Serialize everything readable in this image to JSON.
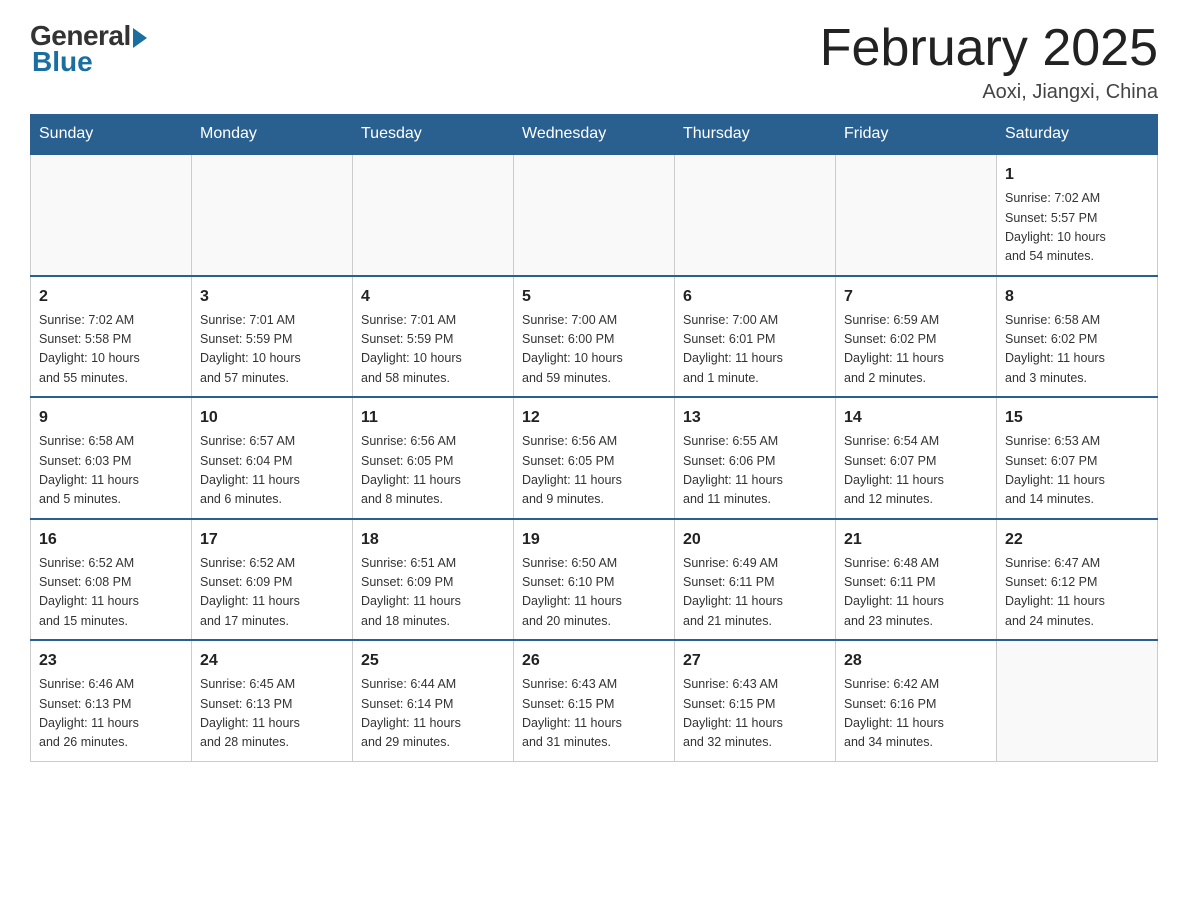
{
  "header": {
    "logo_general": "General",
    "logo_blue": "Blue",
    "month_title": "February 2025",
    "location": "Aoxi, Jiangxi, China"
  },
  "weekdays": [
    "Sunday",
    "Monday",
    "Tuesday",
    "Wednesday",
    "Thursday",
    "Friday",
    "Saturday"
  ],
  "weeks": [
    [
      {
        "day": "",
        "info": ""
      },
      {
        "day": "",
        "info": ""
      },
      {
        "day": "",
        "info": ""
      },
      {
        "day": "",
        "info": ""
      },
      {
        "day": "",
        "info": ""
      },
      {
        "day": "",
        "info": ""
      },
      {
        "day": "1",
        "info": "Sunrise: 7:02 AM\nSunset: 5:57 PM\nDaylight: 10 hours\nand 54 minutes."
      }
    ],
    [
      {
        "day": "2",
        "info": "Sunrise: 7:02 AM\nSunset: 5:58 PM\nDaylight: 10 hours\nand 55 minutes."
      },
      {
        "day": "3",
        "info": "Sunrise: 7:01 AM\nSunset: 5:59 PM\nDaylight: 10 hours\nand 57 minutes."
      },
      {
        "day": "4",
        "info": "Sunrise: 7:01 AM\nSunset: 5:59 PM\nDaylight: 10 hours\nand 58 minutes."
      },
      {
        "day": "5",
        "info": "Sunrise: 7:00 AM\nSunset: 6:00 PM\nDaylight: 10 hours\nand 59 minutes."
      },
      {
        "day": "6",
        "info": "Sunrise: 7:00 AM\nSunset: 6:01 PM\nDaylight: 11 hours\nand 1 minute."
      },
      {
        "day": "7",
        "info": "Sunrise: 6:59 AM\nSunset: 6:02 PM\nDaylight: 11 hours\nand 2 minutes."
      },
      {
        "day": "8",
        "info": "Sunrise: 6:58 AM\nSunset: 6:02 PM\nDaylight: 11 hours\nand 3 minutes."
      }
    ],
    [
      {
        "day": "9",
        "info": "Sunrise: 6:58 AM\nSunset: 6:03 PM\nDaylight: 11 hours\nand 5 minutes."
      },
      {
        "day": "10",
        "info": "Sunrise: 6:57 AM\nSunset: 6:04 PM\nDaylight: 11 hours\nand 6 minutes."
      },
      {
        "day": "11",
        "info": "Sunrise: 6:56 AM\nSunset: 6:05 PM\nDaylight: 11 hours\nand 8 minutes."
      },
      {
        "day": "12",
        "info": "Sunrise: 6:56 AM\nSunset: 6:05 PM\nDaylight: 11 hours\nand 9 minutes."
      },
      {
        "day": "13",
        "info": "Sunrise: 6:55 AM\nSunset: 6:06 PM\nDaylight: 11 hours\nand 11 minutes."
      },
      {
        "day": "14",
        "info": "Sunrise: 6:54 AM\nSunset: 6:07 PM\nDaylight: 11 hours\nand 12 minutes."
      },
      {
        "day": "15",
        "info": "Sunrise: 6:53 AM\nSunset: 6:07 PM\nDaylight: 11 hours\nand 14 minutes."
      }
    ],
    [
      {
        "day": "16",
        "info": "Sunrise: 6:52 AM\nSunset: 6:08 PM\nDaylight: 11 hours\nand 15 minutes."
      },
      {
        "day": "17",
        "info": "Sunrise: 6:52 AM\nSunset: 6:09 PM\nDaylight: 11 hours\nand 17 minutes."
      },
      {
        "day": "18",
        "info": "Sunrise: 6:51 AM\nSunset: 6:09 PM\nDaylight: 11 hours\nand 18 minutes."
      },
      {
        "day": "19",
        "info": "Sunrise: 6:50 AM\nSunset: 6:10 PM\nDaylight: 11 hours\nand 20 minutes."
      },
      {
        "day": "20",
        "info": "Sunrise: 6:49 AM\nSunset: 6:11 PM\nDaylight: 11 hours\nand 21 minutes."
      },
      {
        "day": "21",
        "info": "Sunrise: 6:48 AM\nSunset: 6:11 PM\nDaylight: 11 hours\nand 23 minutes."
      },
      {
        "day": "22",
        "info": "Sunrise: 6:47 AM\nSunset: 6:12 PM\nDaylight: 11 hours\nand 24 minutes."
      }
    ],
    [
      {
        "day": "23",
        "info": "Sunrise: 6:46 AM\nSunset: 6:13 PM\nDaylight: 11 hours\nand 26 minutes."
      },
      {
        "day": "24",
        "info": "Sunrise: 6:45 AM\nSunset: 6:13 PM\nDaylight: 11 hours\nand 28 minutes."
      },
      {
        "day": "25",
        "info": "Sunrise: 6:44 AM\nSunset: 6:14 PM\nDaylight: 11 hours\nand 29 minutes."
      },
      {
        "day": "26",
        "info": "Sunrise: 6:43 AM\nSunset: 6:15 PM\nDaylight: 11 hours\nand 31 minutes."
      },
      {
        "day": "27",
        "info": "Sunrise: 6:43 AM\nSunset: 6:15 PM\nDaylight: 11 hours\nand 32 minutes."
      },
      {
        "day": "28",
        "info": "Sunrise: 6:42 AM\nSunset: 6:16 PM\nDaylight: 11 hours\nand 34 minutes."
      },
      {
        "day": "",
        "info": ""
      }
    ]
  ]
}
